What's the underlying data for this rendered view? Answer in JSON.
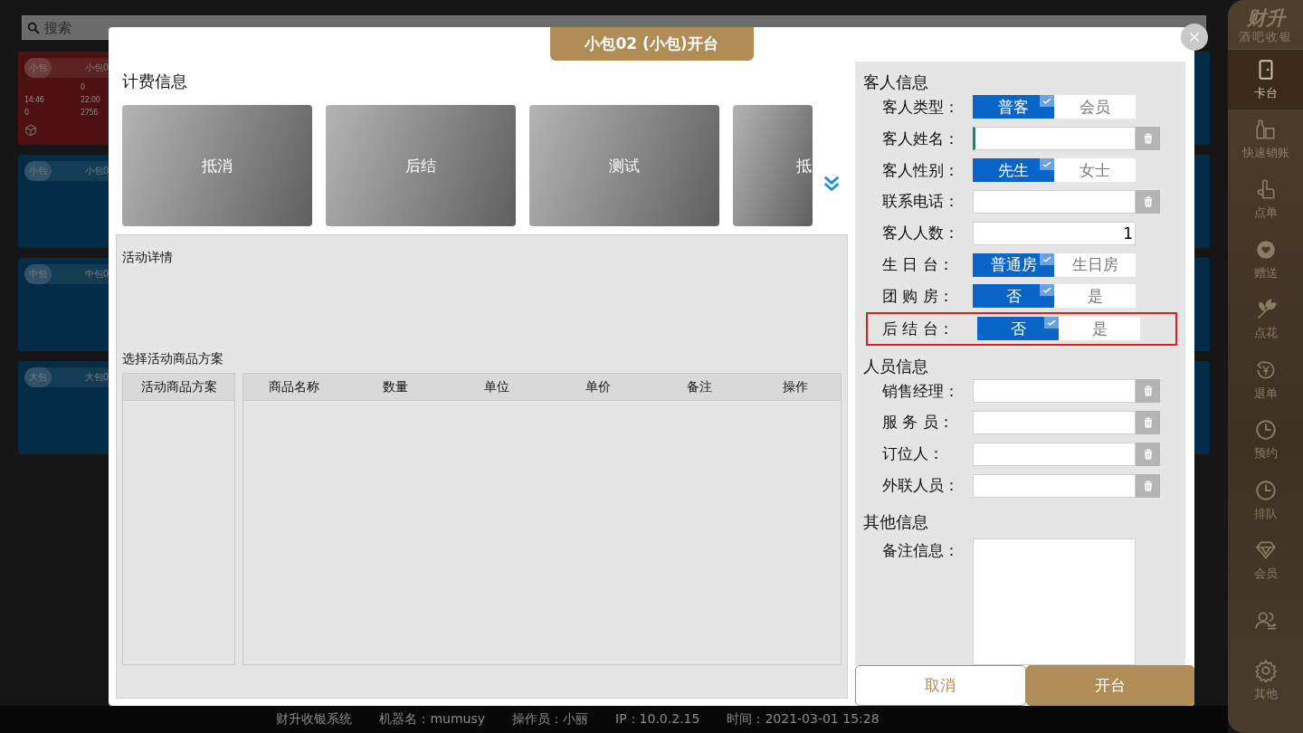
{
  "search": {
    "placeholder": "搜索"
  },
  "room_cards": [
    {
      "kind": "occupied",
      "type": "小包",
      "name": "小包0",
      "rows": [
        [
          "",
          "0"
        ],
        [
          "14:46",
          "22:00"
        ],
        [
          "0",
          "2756"
        ]
      ]
    },
    {
      "kind": "free",
      "type": "小包",
      "name": "小包0"
    },
    {
      "kind": "free",
      "type": "中包",
      "name": "中包0"
    },
    {
      "kind": "free",
      "type": "大包",
      "name": "大包0"
    }
  ],
  "sidebar": {
    "logo": "财升",
    "subtitle": "酒吧收银",
    "items": [
      {
        "kind": "door",
        "label": "卡台",
        "selected": true
      },
      {
        "kind": "bottle",
        "label": "快速销账",
        "selected": false
      },
      {
        "kind": "hand",
        "label": "点单",
        "selected": false
      },
      {
        "kind": "gift",
        "label": "赠送",
        "selected": false
      },
      {
        "kind": "flower",
        "label": "点花",
        "selected": false
      },
      {
        "kind": "refund",
        "label": "退单",
        "selected": false
      },
      {
        "kind": "clock",
        "label": "预约",
        "selected": false
      },
      {
        "kind": "clock",
        "label": "排队",
        "selected": false
      },
      {
        "kind": "diamond",
        "label": "会员",
        "selected": false
      },
      {
        "kind": "users",
        "selected": false
      },
      {
        "kind": "gear",
        "label": "其他",
        "selected": false
      }
    ]
  },
  "dialog": {
    "title": "小包02 (小包)开台",
    "billing": {
      "heading": "计费信息",
      "plans": [
        "抵消",
        "后结",
        "测试",
        "抵"
      ]
    },
    "activity": {
      "details_heading": "活动详情",
      "plan_heading": "选择活动商品方案",
      "plan_table": {
        "columns": [
          "活动商品方案"
        ]
      },
      "goods_table": {
        "columns": [
          "商品名称",
          "数量",
          "单位",
          "单价",
          "备注",
          "操作"
        ]
      }
    },
    "sections": [
      {
        "heading": "客人信息",
        "fields": [
          {
            "kind": "toggle",
            "label": "客人类型：",
            "options": [
              {
                "label": "普客",
                "selected": true
              },
              {
                "label": "会员",
                "selected": false
              }
            ]
          },
          {
            "kind": "input",
            "label": "客人姓名：",
            "focused": true,
            "clearable": true
          },
          {
            "kind": "toggle",
            "label": "客人性别：",
            "options": [
              {
                "label": "先生",
                "selected": true
              },
              {
                "label": "女士",
                "selected": false
              }
            ]
          },
          {
            "kind": "input",
            "label": "联系电话：",
            "focused": false,
            "clearable": true
          },
          {
            "kind": "input",
            "label": "客人人数：",
            "focused": false,
            "clearable": false,
            "value": "1"
          },
          {
            "kind": "toggle",
            "label": "生 日 台：",
            "options": [
              {
                "label": "普通房",
                "selected": true
              },
              {
                "label": "生日房",
                "selected": false
              }
            ]
          },
          {
            "kind": "toggle",
            "label": "团 购 房：",
            "options": [
              {
                "label": "否",
                "selected": true
              },
              {
                "label": "是",
                "selected": false
              }
            ]
          },
          {
            "kind": "toggle",
            "label": "后 结 台：",
            "highlighted": true,
            "options": [
              {
                "label": "否",
                "selected": true
              },
              {
                "label": "是",
                "selected": false
              }
            ]
          }
        ]
      },
      {
        "heading": "人员信息",
        "fields": [
          {
            "kind": "input",
            "label": "销售经理：",
            "focused": false,
            "clearable": true
          },
          {
            "kind": "input",
            "label": "服 务 员：",
            "focused": false,
            "clearable": true
          },
          {
            "kind": "input",
            "label": "订位人：",
            "focused": false,
            "clearable": true
          },
          {
            "kind": "input",
            "label": "外联人员：",
            "focused": false,
            "clearable": true
          }
        ]
      },
      {
        "heading": "其他信息",
        "fields": [
          {
            "kind": "textarea",
            "label": "备注信息："
          }
        ]
      }
    ],
    "buttons": [
      {
        "kind": "secondary",
        "label": "取消"
      },
      {
        "kind": "primary",
        "label": "开台"
      }
    ]
  },
  "status_bar": [
    "财升收银系统",
    "机器名：mumusy",
    "操作员：小丽",
    "IP：10.0.2.15",
    "时间：2021-03-01 15:28"
  ]
}
